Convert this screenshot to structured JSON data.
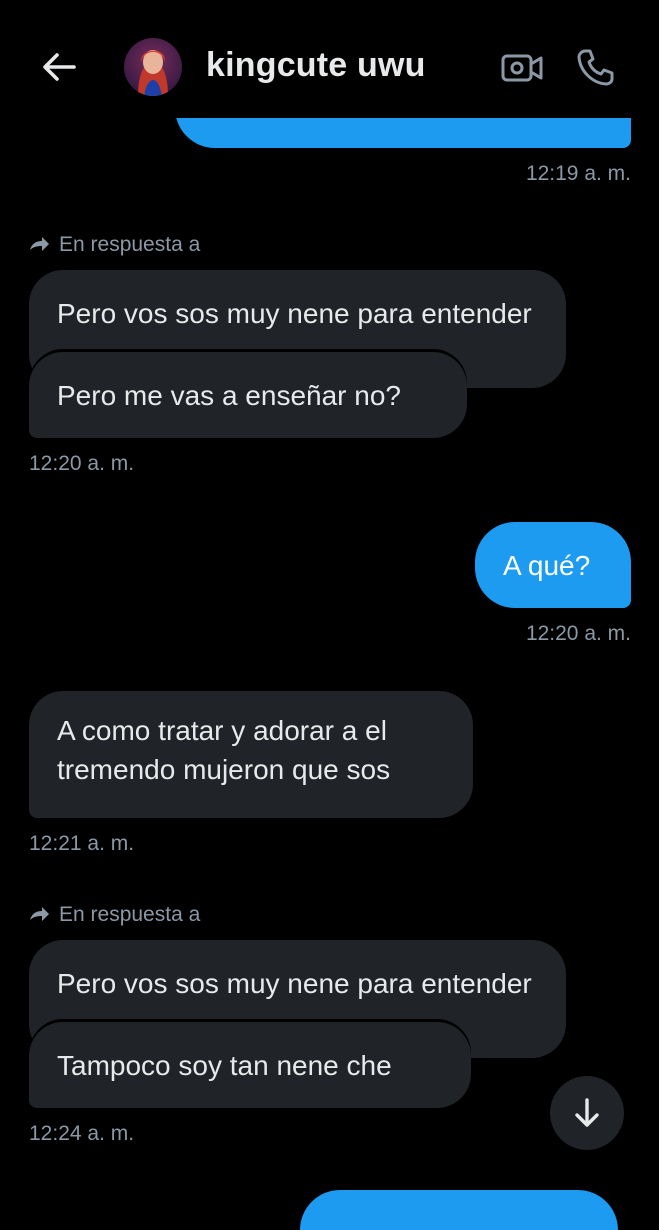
{
  "header": {
    "back_icon": "arrow-left-icon",
    "contact_name": "kingcute uwu",
    "video_icon": "video-camera-icon",
    "call_icon": "phone-icon"
  },
  "colors": {
    "background": "#000000",
    "incoming_bubble": "#202327",
    "outgoing_bubble": "#1d9bf0",
    "muted_text": "#8b98a5",
    "primary_text": "#e7e9ea"
  },
  "messages": [
    {
      "direction": "out",
      "text": "",
      "time": "12:19 a. m.",
      "partially_visible": true
    },
    {
      "direction": "in",
      "reply_context": "En respuesta a",
      "quoted": "Pero vos sos muy nene para entender",
      "text": "Pero me vas a enseñar no?",
      "time": "12:20 a. m."
    },
    {
      "direction": "out",
      "text": "A qué?",
      "time": "12:20 a. m."
    },
    {
      "direction": "in",
      "text_lines": [
        "A como tratar y adorar a el",
        "tremendo mujeron que sos"
      ],
      "time": "12:21 a. m."
    },
    {
      "direction": "in",
      "reply_context": "En respuesta a",
      "quoted": "Pero vos sos muy nene para entender",
      "text": "Tampoco soy tan nene che",
      "time": "12:24 a. m."
    }
  ],
  "scroll_button": {
    "icon": "arrow-down-icon"
  }
}
